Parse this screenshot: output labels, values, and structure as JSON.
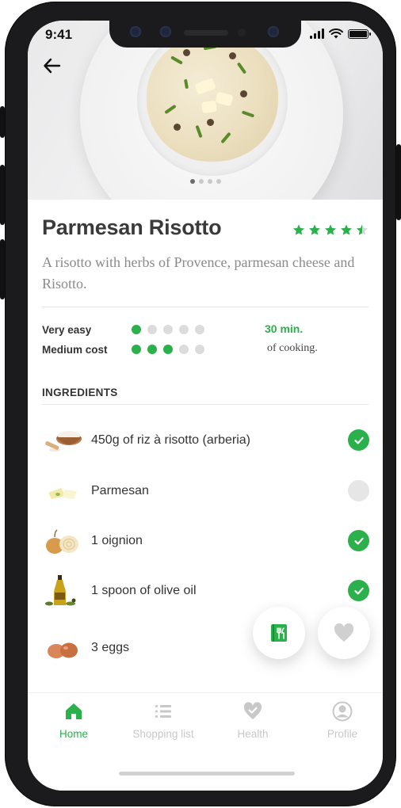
{
  "status_bar": {
    "time": "9:41"
  },
  "hero": {
    "image": "parmesan-risotto-dish",
    "carousel": {
      "count": 4,
      "active": 0
    }
  },
  "recipe": {
    "title": "Parmesan Risotto",
    "rating": 4.5,
    "rating_max": 5,
    "description": "A risotto with herbs of Provence, parmesan cheese and Risotto.",
    "difficulty": {
      "label": "Very easy",
      "level": 1,
      "max": 5
    },
    "cost": {
      "label": "Medium cost",
      "level": 3,
      "max": 5
    },
    "time": {
      "value": "30 min.",
      "suffix": "of cooking."
    }
  },
  "ingredients": {
    "heading": "INGREDIENTS",
    "items": [
      {
        "name": "450g of riz à risotto (arberia)",
        "icon": "rice-bowl",
        "checked": true
      },
      {
        "name": "Parmesan",
        "icon": "parmesan-cheese",
        "checked": false
      },
      {
        "name": "1 oignion",
        "icon": "onion",
        "checked": true
      },
      {
        "name": "1 spoon of olive oil",
        "icon": "olive-oil-bottle",
        "checked": true
      },
      {
        "name": "3 eggs",
        "icon": "eggs",
        "checked": null
      }
    ]
  },
  "actions": {
    "menu_icon": "restaurant-book-icon",
    "favorite_icon": "heart-icon"
  },
  "colors": {
    "accent": "#2bb04c",
    "inactive": "#c8c8c8",
    "text": "#333333"
  },
  "tabs": [
    {
      "label": "Home",
      "icon": "home-icon",
      "active": true
    },
    {
      "label": "Shopping list",
      "icon": "list-icon",
      "active": false
    },
    {
      "label": "Health",
      "icon": "heart-check-icon",
      "active": false
    },
    {
      "label": "Profile",
      "icon": "profile-icon",
      "active": false
    }
  ]
}
